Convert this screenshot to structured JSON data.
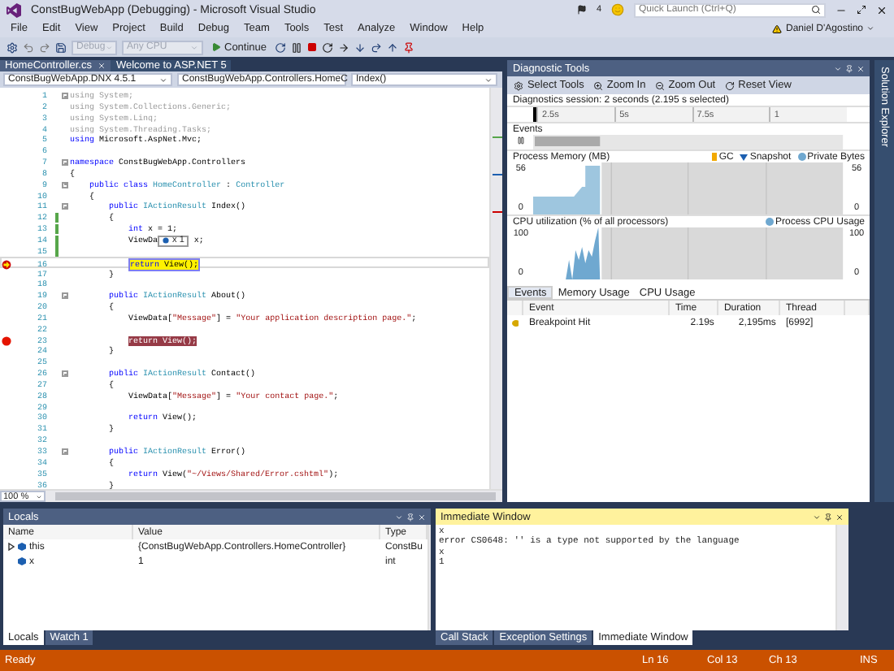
{
  "window": {
    "title": "ConstBugWebApp (Debugging) - Microsoft Visual Studio",
    "notifications": "4",
    "quick_launch": {
      "placeholder": "Quick Launch (Ctrl+Q)"
    },
    "user": "Daniel D'Agostino"
  },
  "menu": [
    "File",
    "Edit",
    "View",
    "Project",
    "Build",
    "Debug",
    "Team",
    "Tools",
    "Test",
    "Analyze",
    "Window",
    "Help"
  ],
  "toolbar": {
    "configuration": {
      "text": "Debug",
      "disabled": true
    },
    "platform": {
      "text": "Any CPU",
      "disabled": true
    },
    "continue": "Continue"
  },
  "document_tabs": [
    {
      "label": "HomeController.cs",
      "selected": true
    },
    {
      "label": "Welcome to ASP.NET 5",
      "selected": false
    }
  ],
  "navigation": [
    "ConstBugWebApp.DNX 4.5.1",
    "ConstBugWebApp.Controllers.HomeC",
    "Index()"
  ],
  "code": {
    "zoom": "100 %",
    "lines": [
      {
        "number": "1",
        "current": false,
        "breakpoint": false,
        "changed": false,
        "fold": true,
        "segments": [
          {
            "kind": "dim",
            "text": "using System;"
          }
        ]
      },
      {
        "number": "2",
        "current": false,
        "breakpoint": false,
        "changed": false,
        "fold": false,
        "segments": [
          {
            "kind": "dim",
            "text": "using System.Collections.Generic;"
          }
        ]
      },
      {
        "number": "3",
        "current": false,
        "breakpoint": false,
        "changed": false,
        "fold": false,
        "segments": [
          {
            "kind": "dim",
            "text": "using System.Linq;"
          }
        ]
      },
      {
        "number": "4",
        "current": false,
        "breakpoint": false,
        "changed": false,
        "fold": false,
        "segments": [
          {
            "kind": "dim",
            "text": "using System.Threading.Tasks;"
          }
        ]
      },
      {
        "number": "5",
        "current": false,
        "breakpoint": false,
        "changed": false,
        "fold": false,
        "segments": [
          {
            "kind": "keyword",
            "text": "using"
          },
          {
            "kind": "plain",
            "text": " Microsoft.AspNet.Mvc;"
          }
        ]
      },
      {
        "number": "6",
        "current": false,
        "breakpoint": false,
        "changed": false,
        "fold": false
      },
      {
        "number": "7",
        "current": false,
        "breakpoint": false,
        "changed": false,
        "fold": true,
        "segments": [
          {
            "kind": "keyword",
            "text": "namespace"
          },
          {
            "kind": "plain",
            "text": " ConstBugWebApp.Controllers"
          }
        ]
      },
      {
        "number": "8",
        "current": false,
        "breakpoint": false,
        "changed": false,
        "fold": false,
        "segments": [
          {
            "kind": "plain",
            "text": "{"
          }
        ]
      },
      {
        "number": "9",
        "current": false,
        "breakpoint": false,
        "changed": false,
        "fold": true,
        "segments": [
          {
            "kind": "keyword",
            "text": "    public class "
          },
          {
            "kind": "type",
            "text": "HomeController"
          },
          {
            "kind": "plain",
            "text": " : "
          },
          {
            "kind": "type",
            "text": "Controller"
          }
        ]
      },
      {
        "number": "10",
        "current": false,
        "breakpoint": false,
        "changed": false,
        "fold": false,
        "segments": [
          {
            "kind": "plain",
            "text": "    {"
          }
        ]
      },
      {
        "number": "11",
        "current": false,
        "breakpoint": false,
        "changed": false,
        "fold": true,
        "segments": [
          {
            "kind": "keyword",
            "text": "        public "
          },
          {
            "kind": "type",
            "text": "IActionResult"
          },
          {
            "kind": "plain",
            "text": " Index()"
          }
        ]
      },
      {
        "number": "12",
        "current": false,
        "breakpoint": false,
        "changed": true,
        "fold": false,
        "segments": [
          {
            "kind": "plain",
            "text": "        {"
          }
        ]
      },
      {
        "number": "13",
        "current": false,
        "breakpoint": false,
        "changed": true,
        "fold": false,
        "segments": [
          {
            "kind": "keyword",
            "text": "            int"
          },
          {
            "kind": "plain",
            "text": " x = 1;"
          }
        ]
      },
      {
        "number": "14",
        "current": false,
        "breakpoint": false,
        "changed": true,
        "fold": false,
        "segments": [
          {
            "kind": "plain",
            "text": "            ViewDa"
          },
          {
            "kind": "datatip",
            "name": "x",
            "value": "1"
          },
          {
            "kind": "plain",
            "text": " x;"
          }
        ]
      },
      {
        "number": "15",
        "current": false,
        "breakpoint": false,
        "changed": true,
        "fold": false
      },
      {
        "number": "16",
        "current": true,
        "breakpoint": false,
        "changed": false,
        "fold": false,
        "segments": [
          {
            "kind": "keyword",
            "text": "            return"
          },
          {
            "kind": "plain",
            "text": " View();"
          }
        ]
      },
      {
        "number": "17",
        "current": false,
        "breakpoint": false,
        "changed": false,
        "fold": false,
        "segments": [
          {
            "kind": "plain",
            "text": "        }"
          }
        ]
      },
      {
        "number": "18",
        "current": false,
        "breakpoint": false,
        "changed": false,
        "fold": false
      },
      {
        "number": "19",
        "current": false,
        "breakpoint": false,
        "changed": false,
        "fold": true,
        "segments": [
          {
            "kind": "keyword",
            "text": "        public "
          },
          {
            "kind": "type",
            "text": "IActionResult"
          },
          {
            "kind": "plain",
            "text": " About()"
          }
        ]
      },
      {
        "number": "20",
        "current": false,
        "breakpoint": false,
        "changed": false,
        "fold": false,
        "segments": [
          {
            "kind": "plain",
            "text": "        {"
          }
        ]
      },
      {
        "number": "21",
        "current": false,
        "breakpoint": false,
        "changed": false,
        "fold": false,
        "segments": [
          {
            "kind": "plain",
            "text": "            ViewData["
          },
          {
            "kind": "string",
            "text": "\"Message\""
          },
          {
            "kind": "plain",
            "text": "] = "
          },
          {
            "kind": "string",
            "text": "\"Your application description page.\""
          },
          {
            "kind": "plain",
            "text": ";"
          }
        ]
      },
      {
        "number": "22",
        "current": false,
        "breakpoint": false,
        "changed": false,
        "fold": false
      },
      {
        "number": "23",
        "current": false,
        "breakpoint": true,
        "changed": false,
        "fold": false,
        "segments": [
          {
            "kind": "plain",
            "text": "            return View();"
          }
        ]
      },
      {
        "number": "24",
        "current": false,
        "breakpoint": false,
        "changed": false,
        "fold": false,
        "segments": [
          {
            "kind": "plain",
            "text": "        }"
          }
        ]
      },
      {
        "number": "25",
        "current": false,
        "breakpoint": false,
        "changed": false,
        "fold": false
      },
      {
        "number": "26",
        "current": false,
        "breakpoint": false,
        "changed": false,
        "fold": true,
        "segments": [
          {
            "kind": "keyword",
            "text": "        public "
          },
          {
            "kind": "type",
            "text": "IActionResult"
          },
          {
            "kind": "plain",
            "text": " Contact()"
          }
        ]
      },
      {
        "number": "27",
        "current": false,
        "breakpoint": false,
        "changed": false,
        "fold": false,
        "segments": [
          {
            "kind": "plain",
            "text": "        {"
          }
        ]
      },
      {
        "number": "28",
        "current": false,
        "breakpoint": false,
        "changed": false,
        "fold": false,
        "segments": [
          {
            "kind": "plain",
            "text": "            ViewData["
          },
          {
            "kind": "string",
            "text": "\"Message\""
          },
          {
            "kind": "plain",
            "text": "] = "
          },
          {
            "kind": "string",
            "text": "\"Your contact page.\""
          },
          {
            "kind": "plain",
            "text": ";"
          }
        ]
      },
      {
        "number": "29",
        "current": false,
        "breakpoint": false,
        "changed": false,
        "fold": false
      },
      {
        "number": "30",
        "current": false,
        "breakpoint": false,
        "changed": false,
        "fold": false,
        "segments": [
          {
            "kind": "keyword",
            "text": "            return"
          },
          {
            "kind": "plain",
            "text": " View();"
          }
        ]
      },
      {
        "number": "31",
        "current": false,
        "breakpoint": false,
        "changed": false,
        "fold": false,
        "segments": [
          {
            "kind": "plain",
            "text": "        }"
          }
        ]
      },
      {
        "number": "32",
        "current": false,
        "breakpoint": false,
        "changed": false,
        "fold": false
      },
      {
        "number": "33",
        "current": false,
        "breakpoint": false,
        "changed": false,
        "fold": true,
        "segments": [
          {
            "kind": "keyword",
            "text": "        public "
          },
          {
            "kind": "type",
            "text": "IActionResult"
          },
          {
            "kind": "plain",
            "text": " Error()"
          }
        ]
      },
      {
        "number": "34",
        "current": false,
        "breakpoint": false,
        "changed": false,
        "fold": false,
        "segments": [
          {
            "kind": "plain",
            "text": "        {"
          }
        ]
      },
      {
        "number": "35",
        "current": false,
        "breakpoint": false,
        "changed": false,
        "fold": false,
        "segments": [
          {
            "kind": "keyword",
            "text": "            return"
          },
          {
            "kind": "plain",
            "text": " View("
          },
          {
            "kind": "string",
            "text": "\"~/Views/Shared/Error.cshtml\""
          },
          {
            "kind": "plain",
            "text": ");"
          }
        ]
      },
      {
        "number": "36",
        "current": false,
        "breakpoint": false,
        "changed": false,
        "fold": false,
        "segments": [
          {
            "kind": "plain",
            "text": "        }"
          }
        ]
      }
    ]
  },
  "diagnostic_tools": {
    "title": "Diagnostic Tools",
    "toolbar": [
      "Select Tools",
      "Zoom In",
      "Zoom Out",
      "Reset View"
    ],
    "session": "Diagnostics session: 2 seconds (2.195 s selected)",
    "ruler": [
      "2.5s",
      "5s",
      "7.5s",
      "1"
    ],
    "events_label": "Events",
    "memory": {
      "title": "Process Memory (MB)",
      "legend": [
        "GC",
        "Snapshot",
        "Private Bytes"
      ],
      "left_axis": [
        "56",
        "0"
      ],
      "right_axis": [
        "56",
        "0"
      ]
    },
    "cpu": {
      "title": "CPU utilization (% of all processors)",
      "legend": [
        "Process CPU Usage"
      ],
      "left_axis": [
        "100",
        "0"
      ],
      "right_axis": [
        "100",
        "0"
      ]
    },
    "tabs": [
      {
        "label": "Events",
        "selected": true
      },
      {
        "label": "Memory Usage",
        "selected": false
      },
      {
        "label": "CPU Usage",
        "selected": false
      }
    ],
    "columns": [
      "Event",
      "Time",
      "Duration",
      "Thread"
    ],
    "rows": [
      {
        "event": "Breakpoint Hit",
        "time": "2.19s",
        "duration": "2,195ms",
        "thread": "[6992]"
      }
    ]
  },
  "side_panel": "Solution Explorer",
  "locals": {
    "title": "Locals",
    "columns": [
      "Name",
      "Value",
      "Type"
    ],
    "rows": [
      {
        "name": "this",
        "value": "{ConstBugWebApp.Controllers.HomeController}",
        "type": "ConstBu",
        "expandable": true
      },
      {
        "name": "x",
        "value": "1",
        "type": "int",
        "expandable": false
      }
    ],
    "tabs": [
      {
        "label": "Locals",
        "selected": true
      },
      {
        "label": "Watch 1",
        "selected": false
      }
    ]
  },
  "immediate": {
    "title": "Immediate Window",
    "lines": [
      "x",
      "error CS0648: '' is a type not supported by the language",
      "x",
      "1"
    ],
    "tabs": [
      {
        "label": "Call Stack",
        "selected": false
      },
      {
        "label": "Exception Settings",
        "selected": false
      },
      {
        "label": "Immediate Window",
        "selected": true
      }
    ]
  },
  "status_bar": {
    "message": "Ready",
    "line": "Ln 16",
    "column": "Col 13",
    "char": "Ch 13",
    "mode": "INS"
  }
}
